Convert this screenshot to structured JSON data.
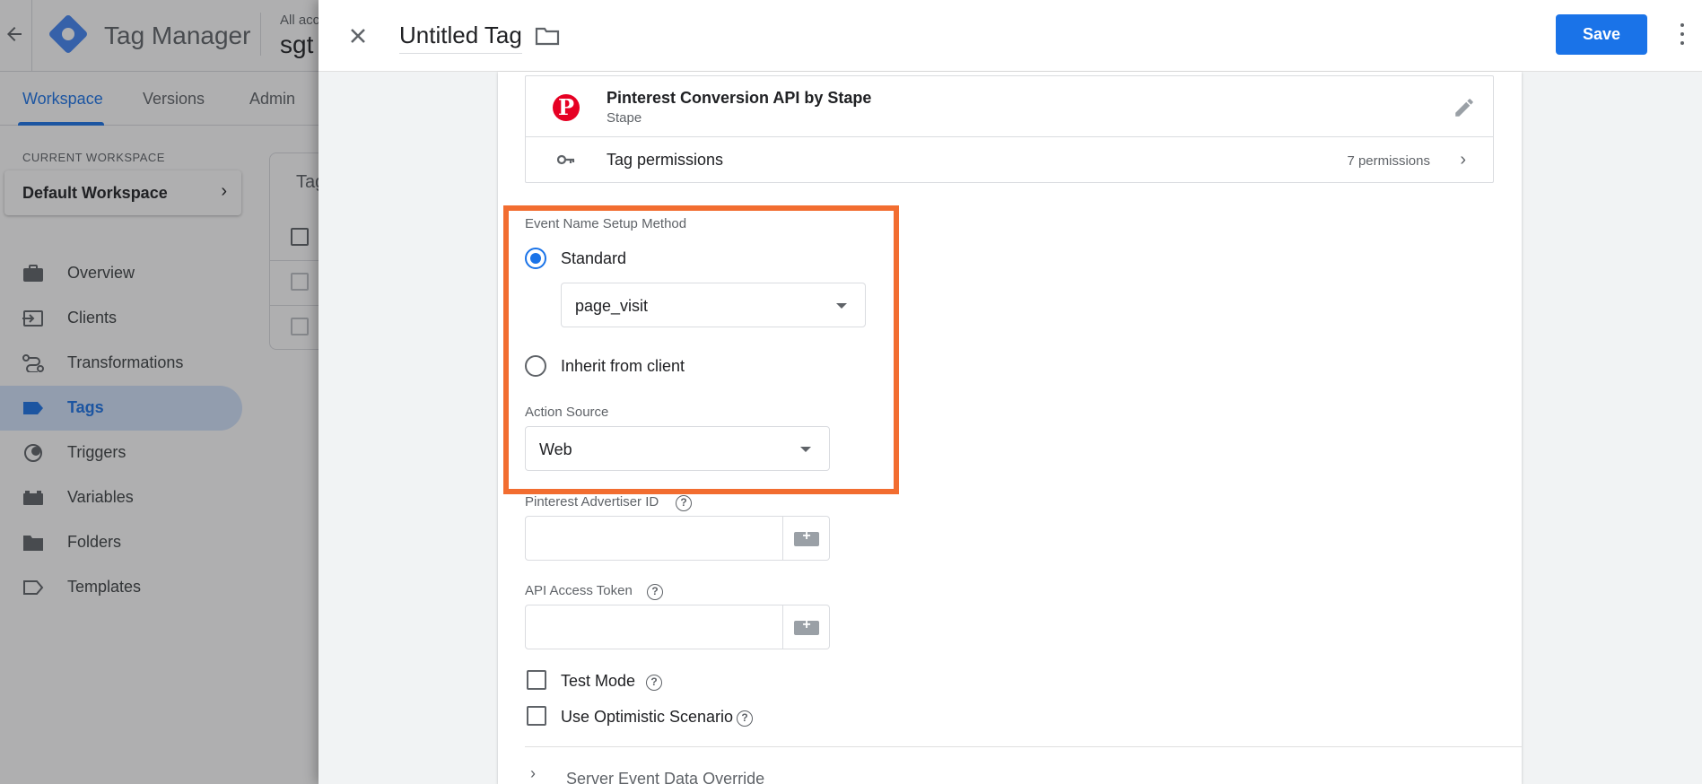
{
  "app": {
    "title": "Tag Manager",
    "account_label": "All acc",
    "container_name": "sgt",
    "tabs": [
      "Workspace",
      "Versions",
      "Admin"
    ],
    "current_workspace_label": "CURRENT WORKSPACE",
    "workspace_name": "Default Workspace",
    "nav": [
      {
        "label": "Overview",
        "icon": "briefcase-icon"
      },
      {
        "label": "Clients",
        "icon": "login-icon"
      },
      {
        "label": "Transformations",
        "icon": "route-icon"
      },
      {
        "label": "Tags",
        "icon": "tag-icon",
        "active": true
      },
      {
        "label": "Triggers",
        "icon": "trigger-icon"
      },
      {
        "label": "Variables",
        "icon": "variables-icon"
      },
      {
        "label": "Folders",
        "icon": "folder-icon"
      },
      {
        "label": "Templates",
        "icon": "template-icon"
      }
    ],
    "card_title": "Tag"
  },
  "sheet": {
    "tag_name": "Untitled Tag",
    "save_label": "Save",
    "template": {
      "name": "Pinterest Conversion API by Stape",
      "author": "Stape",
      "permissions_label": "Tag permissions",
      "permissions_count": "7 permissions"
    },
    "event_name": {
      "label": "Event Name Setup Method",
      "options": [
        {
          "label": "Standard",
          "checked": true
        },
        {
          "label": "Inherit from client",
          "checked": false
        }
      ],
      "standard_value": "page_visit"
    },
    "action_source": {
      "label": "Action Source",
      "value": "Web"
    },
    "advertiser_id": {
      "label": "Pinterest Advertiser ID",
      "value": ""
    },
    "api_token": {
      "label": "API Access Token",
      "value": ""
    },
    "test_mode": {
      "label": "Test Mode",
      "checked": false
    },
    "optimistic": {
      "label": "Use Optimistic Scenario",
      "checked": false
    },
    "override_label": "Server Event Data Override",
    "help_glyph": "?"
  },
  "colors": {
    "accent": "#1a73e8",
    "highlight": "#f26d30",
    "pinterest": "#e60023"
  }
}
